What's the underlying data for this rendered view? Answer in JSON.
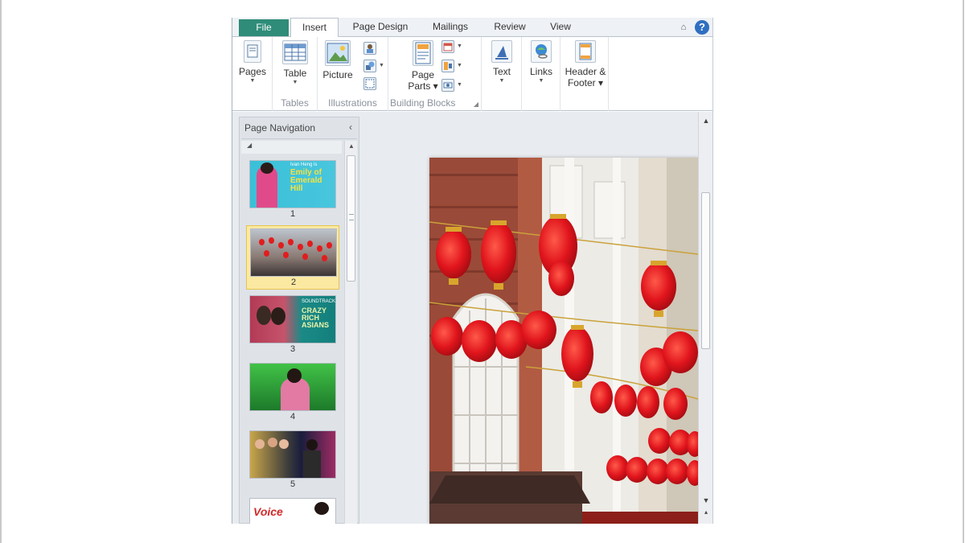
{
  "ribbon_tabs": [
    "File",
    "Insert",
    "Page Design",
    "Mailings",
    "Review",
    "View"
  ],
  "active_tab": "Insert",
  "help_glyph": "?",
  "collapse_glyph": "⌂",
  "groups": {
    "pages": {
      "button_label": "Pages"
    },
    "tables": {
      "button_label": "Table",
      "group_label": "Tables"
    },
    "illustrations": {
      "button_label": "Picture",
      "group_label": "Illustrations"
    },
    "building_blocks": {
      "button_label": "Page Parts",
      "group_label": "Building Blocks"
    },
    "text": {
      "button_label": "Text"
    },
    "links": {
      "button_label": "Links"
    },
    "header_footer": {
      "button_label": "Header & Footer"
    }
  },
  "nav_pane": {
    "title": "Page Navigation",
    "close_glyph": "‹",
    "thumbnails": [
      {
        "number": "1",
        "title_text": "Emily of Emerald Hill",
        "subtitle_text": "Ivan Heng is"
      },
      {
        "number": "2"
      },
      {
        "number": "3",
        "title_text": "CRAZY RICH ASIANS",
        "subtitle_text": "SOUNDTRACK"
      },
      {
        "number": "4"
      },
      {
        "number": "5"
      },
      {
        "number": "",
        "title_text": "Voice"
      }
    ],
    "selected_page": "2"
  },
  "colors": {
    "file_tab": "#2e8c78",
    "selected_thumb": "#fbe9a1",
    "lantern_red": "#e11d1d"
  }
}
